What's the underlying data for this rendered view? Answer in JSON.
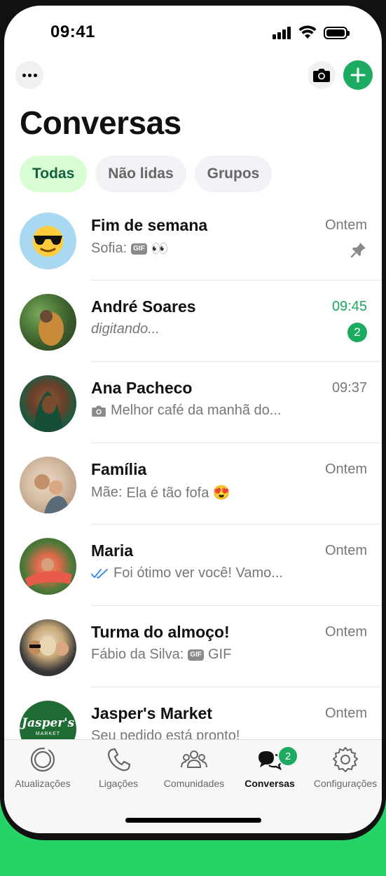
{
  "status_bar": {
    "time": "09:41"
  },
  "header": {
    "title": "Conversas"
  },
  "filters": [
    {
      "label": "Todas",
      "active": true
    },
    {
      "label": "Não lidas",
      "active": false
    },
    {
      "label": "Grupos",
      "active": false
    }
  ],
  "chats": [
    {
      "name": "Fim de semana",
      "sender": "Sofia:",
      "message": "👀",
      "has_gif_tag": true,
      "time": "Ontem",
      "pinned": true,
      "avatar_icon": "sunglasses-emoji-icon"
    },
    {
      "name": "André Soares",
      "message": "digitando...",
      "time": "09:45",
      "unread": "2",
      "typing": true
    },
    {
      "name": "Ana Pacheco",
      "message": "Melhor café da manhã do...",
      "time": "09:37",
      "has_photo_icon": true
    },
    {
      "name": "Família",
      "sender": "Mãe:",
      "message": "Ela é tão fofa 😍",
      "time": "Ontem"
    },
    {
      "name": "Maria",
      "message": "Foi ótimo ver você! Vamo...",
      "time": "Ontem",
      "read_receipt": true
    },
    {
      "name": "Turma do almoço!",
      "sender": "Fábio da Silva:",
      "message": "GIF",
      "has_gif_tag": true,
      "time": "Ontem"
    },
    {
      "name": "Jasper's Market",
      "message": "Seu pedido está pronto!",
      "time": "Ontem",
      "avatar_text": "Jasper's",
      "avatar_subtext": "MARKET"
    }
  ],
  "tabs": [
    {
      "label": "Atualizações",
      "icon": "updates-icon"
    },
    {
      "label": "Ligações",
      "icon": "phone-icon"
    },
    {
      "label": "Comunidades",
      "icon": "communities-icon"
    },
    {
      "label": "Conversas",
      "icon": "chats-icon",
      "active": true,
      "badge": "2"
    },
    {
      "label": "Configurações",
      "icon": "settings-icon"
    }
  ],
  "colors": {
    "accent": "#1daa61",
    "frame": "#25d366",
    "chip_active_bg": "#d9fdd3"
  }
}
